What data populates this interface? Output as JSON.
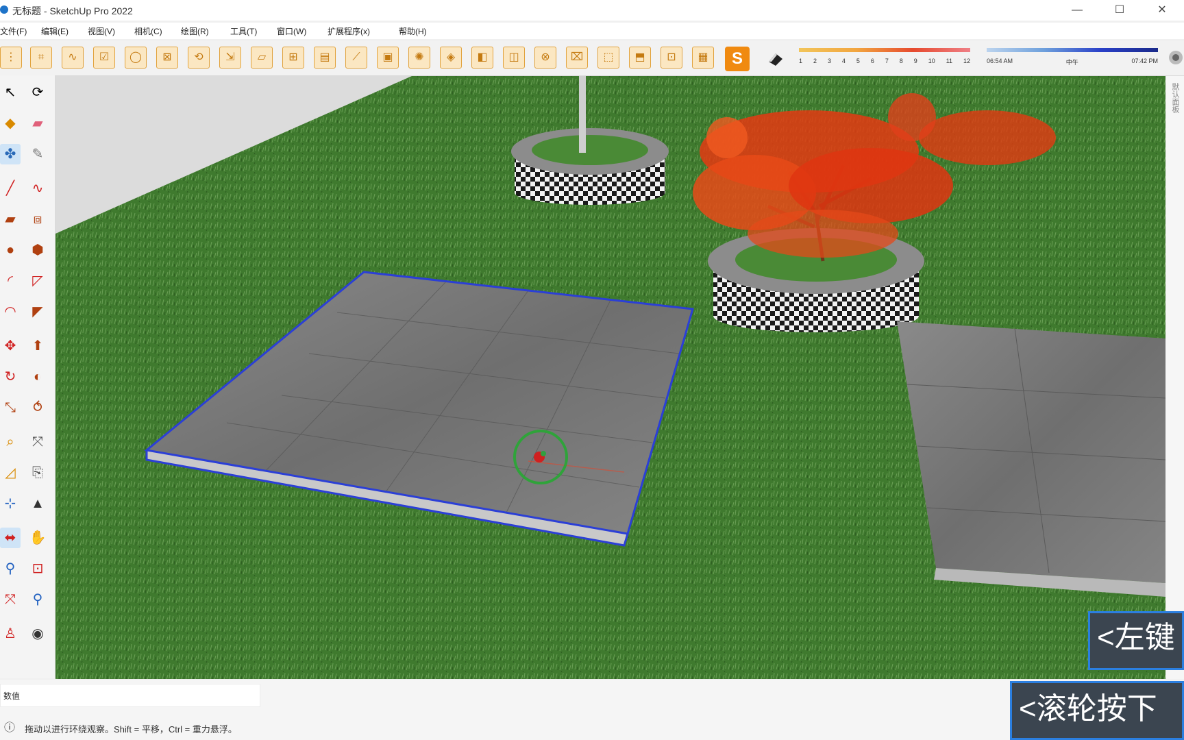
{
  "window": {
    "title": "无标题 - SketchUp Pro 2022",
    "controls": {
      "minimize": "—",
      "maximize": "☐",
      "close": "✕"
    }
  },
  "menu": [
    "文件(F)",
    "编辑(E)",
    "视图(V)",
    "相机(C)",
    "绘图(R)",
    "工具(T)",
    "窗口(W)",
    "扩展程序(x)",
    "帮助(H)"
  ],
  "toolbar": {
    "brand_letter": "S",
    "scale1_ticks": [
      "1",
      "2",
      "3",
      "4",
      "5",
      "6",
      "7",
      "8",
      "9",
      "10",
      "11",
      "12"
    ],
    "scale2_labels": [
      "06:54 AM",
      "中午",
      "07:42 PM"
    ]
  },
  "icons": {
    "left_toolbar": [
      "select",
      "orbit",
      "paint-bucket",
      "eraser",
      "tape",
      "pencil",
      "line",
      "freehand",
      "rectangle",
      "rotated-rectangle",
      "circle",
      "polygon",
      "arc",
      "pie",
      "arc-3pt",
      "arc-2pt",
      "move",
      "push-pull",
      "rotate",
      "follow-me",
      "scale",
      "offset",
      "tape-measure",
      "dimension",
      "protractor",
      "text",
      "axes",
      "section",
      "orbit-view",
      "pan",
      "zoom",
      "zoom-window",
      "zoom-extents",
      "previous",
      "walk",
      "look-around"
    ]
  },
  "tray": {
    "label": "默认面板"
  },
  "status": {
    "measure_label": "数值",
    "hint_text": "拖动以进行环绕观察。Shift = 平移，Ctrl = 重力悬浮。"
  },
  "overlays": {
    "left_hint": "<左键",
    "wheel_hint": "<滚轮按下"
  },
  "colors": {
    "selection": "#2b3fd6",
    "grass": "#3f7a2e",
    "tree": "#e53a12",
    "accent": "#f08a10"
  }
}
